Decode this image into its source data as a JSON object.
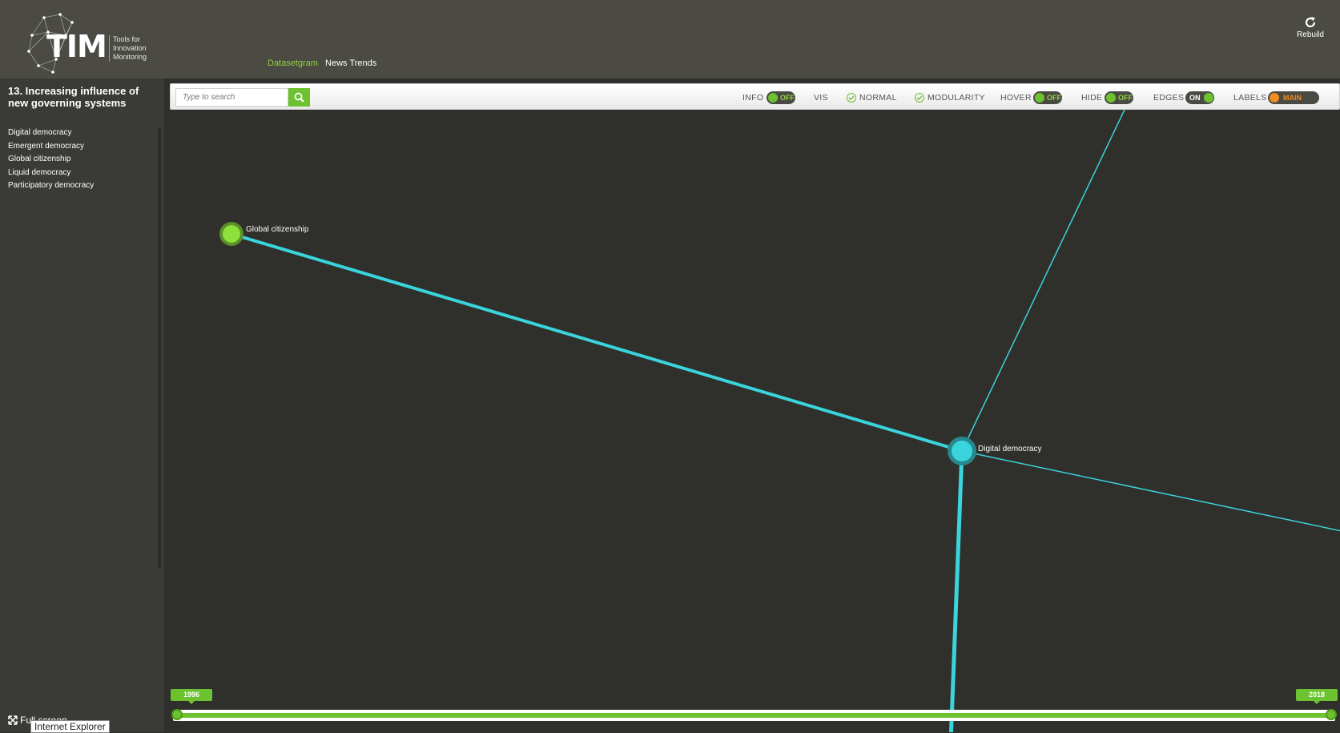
{
  "header": {
    "logo_text": "TIM",
    "logo_subtitle": "Tools for Innovation Monitoring",
    "nav": [
      {
        "label": "Datasetgram"
      },
      {
        "label": "News Trends"
      }
    ],
    "rebuild_label": "Rebuild"
  },
  "sidebar": {
    "title": "13. Increasing influence of new governing systems",
    "items": [
      {
        "label": "Digital democracy"
      },
      {
        "label": "Emergent democracy"
      },
      {
        "label": "Global citizenship"
      },
      {
        "label": "Liquid democracy"
      },
      {
        "label": "Participatory democracy"
      }
    ],
    "fullscreen_label": "Full screen",
    "tooltip": "Internet Explorer"
  },
  "toolbar": {
    "search_placeholder": "Type to search",
    "info_label": "INFO",
    "info_state": "OFF",
    "vis_label": "VIS",
    "normal_label": "NORMAL",
    "modularity_label": "MODULARITY",
    "hover_label": "HOVER",
    "hover_state": "OFF",
    "hide_label": "HIDE",
    "hide_state": "OFF",
    "edges_label": "EDGES",
    "edges_state": "ON",
    "labels_label": "LABELS",
    "labels_state": "MAIN"
  },
  "graph": {
    "nodes": [
      {
        "label": "Global citizenship",
        "color": "#8ee03a"
      },
      {
        "label": "Digital democracy",
        "color": "#3ad4dc"
      }
    ],
    "edge_color": "#3ad4dc"
  },
  "timeline": {
    "start_year": "1996",
    "end_year": "2018"
  },
  "colors": {
    "accent_green": "#6cc22f",
    "accent_orange": "#f08a24",
    "header_bg": "#4b4b44",
    "canvas_bg": "#2f2f2c"
  }
}
